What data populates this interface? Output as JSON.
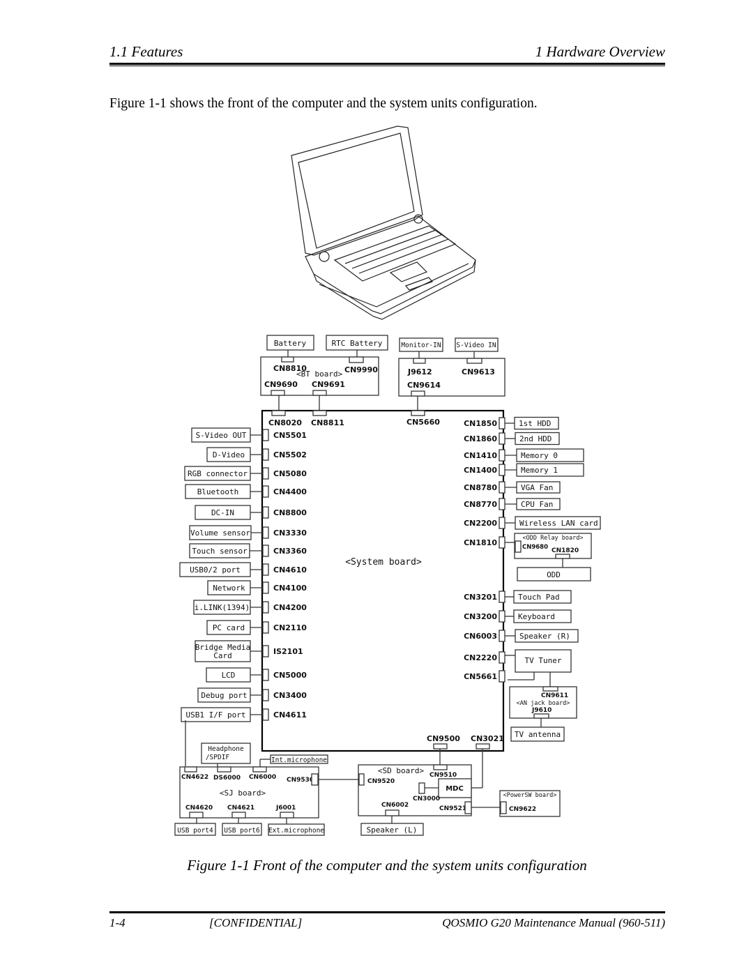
{
  "header": {
    "section": "1.1  Features",
    "chapter": "1  Hardware Overview"
  },
  "intro_text": "Figure 1-1 shows the front of the computer and the system units configuration.",
  "figure_caption": "Figure 1-1 Front of the computer and the system units configuration",
  "footer": {
    "page": "1-4",
    "confidential": "[CONFIDENTIAL]",
    "title": "QOSMIO G20  Maintenance Manual (960-511)"
  },
  "illustration": {
    "icon": "laptop-icon"
  },
  "diagram": {
    "system_board_label": "<System board>",
    "top": {
      "battery": "Battery",
      "rtc_battery": "RTC Battery",
      "monitor_in": "Monitor-IN",
      "svideo_in": "S-Video IN",
      "bt_board_label": "<BT board>",
      "cn8810": "CN8810",
      "cn9990": "CN9990",
      "cn9690": "CN9690",
      "cn9691": "CN9691",
      "j9612": "J9612",
      "cn9613": "CN9613",
      "cn9614": "CN9614",
      "cn8020": "CN8020",
      "cn8811": "CN8811",
      "cn5660": "CN5660"
    },
    "left": [
      {
        "device": "S-Video OUT",
        "connector": "CN5501"
      },
      {
        "device": "D-Video",
        "connector": "CN5502"
      },
      {
        "device": "RGB connector",
        "connector": "CN5080"
      },
      {
        "device": "Bluetooth",
        "connector": "CN4400"
      },
      {
        "device": "DC-IN",
        "connector": "CN8800"
      },
      {
        "device": "Volume sensor",
        "connector": "CN3330"
      },
      {
        "device": "Touch sensor",
        "connector": "CN3360"
      },
      {
        "device": "USB0/2 port",
        "connector": "CN4610"
      },
      {
        "device": "Network",
        "connector": "CN4100"
      },
      {
        "device": "i.LINK(1394)",
        "connector": "CN4200"
      },
      {
        "device": "PC card",
        "connector": "CN2110"
      },
      {
        "device": "Bridge Media",
        "device2": "Card",
        "connector": "IS2101"
      },
      {
        "device": "LCD",
        "connector": "CN5000"
      },
      {
        "device": "Debug port",
        "connector": "CN3400"
      },
      {
        "device": "USB1 I/F port",
        "connector": "CN4611"
      }
    ],
    "right": [
      {
        "device": "1st HDD",
        "connector": "CN1850"
      },
      {
        "device": "2nd HDD",
        "connector": "CN1860"
      },
      {
        "device": "Memory 0",
        "connector": "CN1410"
      },
      {
        "device": "Memory 1",
        "connector": "CN1400"
      },
      {
        "device": "VGA Fan",
        "connector": "CN8780"
      },
      {
        "device": "CPU Fan",
        "connector": "CN8770"
      },
      {
        "device": "Wireless LAN card",
        "connector": "CN2200"
      },
      {
        "device": "<ODD Relay board>",
        "connector": "CN1810"
      },
      {
        "device": "Touch Pad",
        "connector": "CN3201"
      },
      {
        "device": "Keyboard",
        "connector": "CN3200"
      },
      {
        "device": "Speaker (R)",
        "connector": "CN6003"
      },
      {
        "device": "TV Tuner",
        "connector": "CN2220"
      },
      {
        "device": "",
        "connector": "CN5661"
      }
    ],
    "odd_relay": {
      "cn9680": "CN9680",
      "cn1820": "CN1820",
      "odd": "ODD"
    },
    "an_jack": {
      "cn9611": "CN9611",
      "label": "<AN jack board>",
      "j9610": "J9610",
      "tv_antenna": "TV antenna"
    },
    "bottom": {
      "cn9500": "CN9500",
      "cn3021": "CN3021"
    },
    "sj_board": {
      "label": "<SJ board>",
      "headphone": "Headphone",
      "spdif": "/SPDIF",
      "int_mic": "Int.microphone",
      "cn4622": "CN4622",
      "ds6000": "DS6000",
      "cn6000": "CN6000",
      "cn9530": "CN9530",
      "cn4620": "CN4620",
      "cn4621": "CN4621",
      "j6001": "J6001",
      "usb_port4": "USB port4",
      "usb_port6": "USB port6",
      "ext_mic": "Ext.microphone"
    },
    "sd_board": {
      "label": "<SD board>",
      "cn9510": "CN9510",
      "cn9520": "CN9520",
      "mdc": "MDC",
      "cn3000": "CN3000",
      "cn6002": "CN6002",
      "cn9521": "CN9521",
      "speaker_l": "Speaker (L)"
    },
    "powersw_board": {
      "label": "<PowerSW board>",
      "cn9622": "CN9622"
    }
  }
}
